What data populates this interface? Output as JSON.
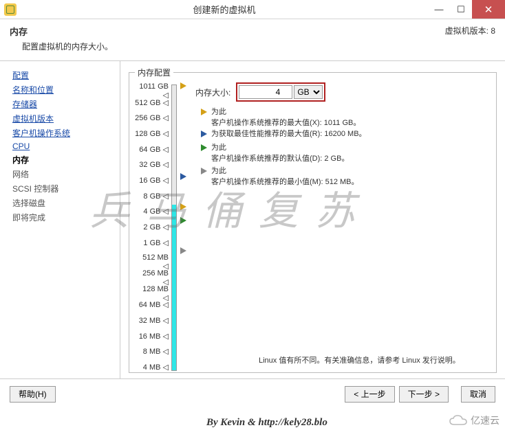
{
  "window": {
    "title": "创建新的虚拟机"
  },
  "header": {
    "title": "内存",
    "subtitle": "配置虚拟机的内存大小。",
    "version": "虚拟机版本: 8"
  },
  "sidebar": {
    "items": [
      {
        "label": "配置",
        "kind": "link"
      },
      {
        "label": "名称和位置",
        "kind": "link"
      },
      {
        "label": "存储器",
        "kind": "link"
      },
      {
        "label": "虚拟机版本",
        "kind": "link"
      },
      {
        "label": "客户机操作系统",
        "kind": "link"
      },
      {
        "label": "CPU",
        "kind": "link"
      },
      {
        "label": "内存",
        "kind": "current"
      },
      {
        "label": "网络",
        "kind": "plain"
      },
      {
        "label": "SCSI 控制器",
        "kind": "plain"
      },
      {
        "label": "选择磁盘",
        "kind": "plain"
      },
      {
        "label": "即将完成",
        "kind": "plain"
      }
    ]
  },
  "memcfg": {
    "legend": "内存配置",
    "size_label": "内存大小:",
    "size_value": "4",
    "unit": "GB",
    "ruler": [
      "1011 GB",
      "512 GB",
      "256 GB",
      "128 GB",
      "64 GB",
      "32 GB",
      "16 GB",
      "8 GB",
      "4 GB",
      "2 GB",
      "1 GB",
      "512 MB",
      "256 MB",
      "128 MB",
      "64 MB",
      "32 MB",
      "16 MB",
      "8 MB",
      "4 MB"
    ],
    "notes": {
      "max_x": {
        "l1": "为此",
        "l2": "客户机操作系统推荐的最大值(X): 1011 GB。"
      },
      "max_r": {
        "l1": "为获取最佳性能推荐的最大值(R): 16200 MB。"
      },
      "def_d": {
        "l1": "为此",
        "l2": "客户机操作系统推荐的默认值(D): 2 GB。"
      },
      "min_m": {
        "l1": "为此",
        "l2": "客户机操作系统推荐的最小值(M): 512 MB。"
      }
    },
    "linux_note": "Linux 值有所不同。有关准确信息，请参考 Linux 发行说明。"
  },
  "footer": {
    "help": "帮助(H)",
    "back": "< 上一步",
    "next": "下一步 >",
    "cancel": "取消"
  },
  "watermark": "兵马俑复苏",
  "credit": "By Kevin & http://kely28.blo",
  "cloud": "亿速云"
}
